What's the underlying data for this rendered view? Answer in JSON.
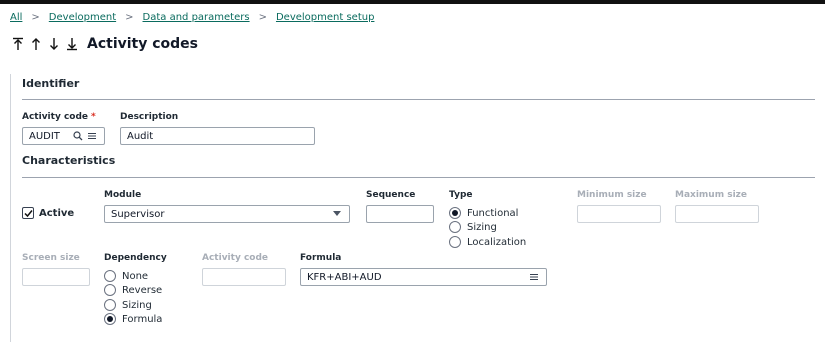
{
  "breadcrumb": {
    "items": [
      "All",
      "Development",
      "Data and parameters",
      "Development setup"
    ]
  },
  "page": {
    "title": "Activity codes"
  },
  "identifier": {
    "section_title": "Identifier",
    "activity_code_label": "Activity code",
    "activity_code_required": "*",
    "activity_code_value": "AUDIT",
    "description_label": "Description",
    "description_value": "Audit"
  },
  "characteristics": {
    "section_title": "Characteristics",
    "active_label": "Active",
    "active_checked": true,
    "module_label": "Module",
    "module_value": "Supervisor",
    "sequence_label": "Sequence",
    "sequence_value": "",
    "type_label": "Type",
    "type_options": [
      "Functional",
      "Sizing",
      "Localization"
    ],
    "type_selected": "Functional",
    "minimum_size_label": "Minimum size",
    "minimum_size_value": "",
    "maximum_size_label": "Maximum size",
    "maximum_size_value": "",
    "screen_size_label": "Screen size",
    "screen_size_value": "",
    "dependency_label": "Dependency",
    "dependency_options": [
      "None",
      "Reverse",
      "Sizing",
      "Formula"
    ],
    "dependency_selected": "Formula",
    "dep_activity_code_label": "Activity code",
    "dep_activity_code_value": "",
    "formula_label": "Formula",
    "formula_value": "KFR+ABI+AUD"
  },
  "colors": {
    "link": "#0a6b5e",
    "required": "#d92d20",
    "disabled_label": "#a8aeb7"
  }
}
